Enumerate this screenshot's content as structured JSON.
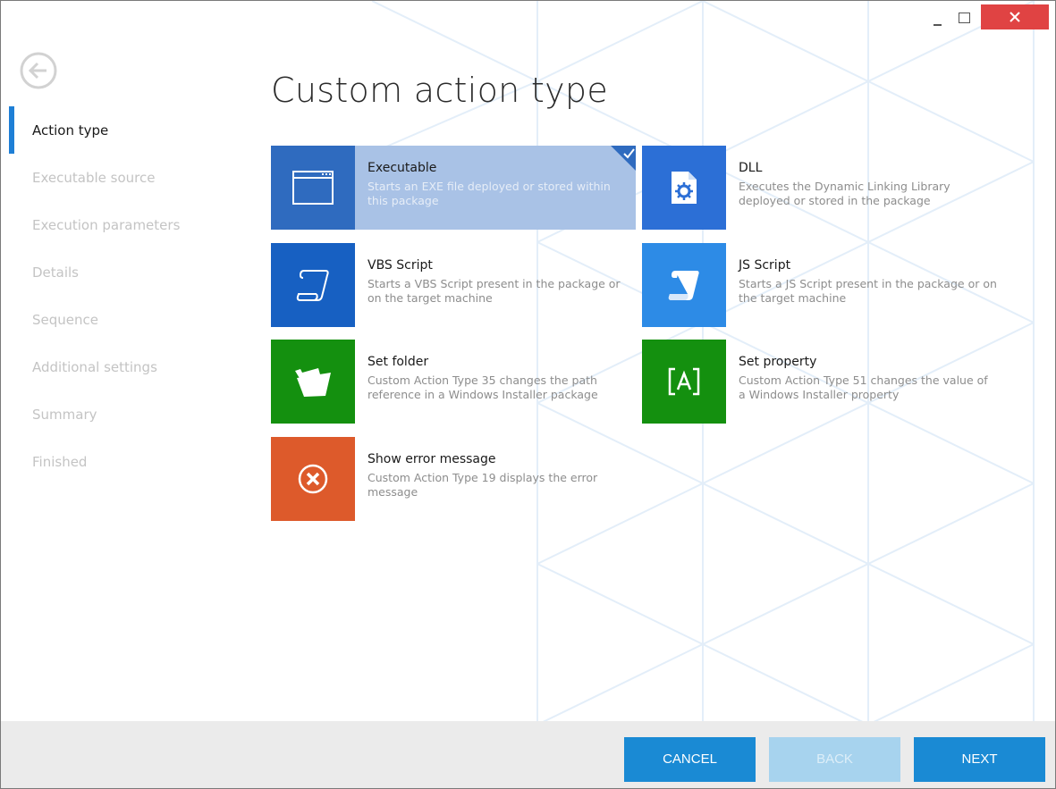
{
  "window": {
    "controls": {
      "minimize": "minimize-icon",
      "maximize": "maximize-icon",
      "close": "close-icon"
    },
    "close_color": "#e04343"
  },
  "back_icon": "back-arrow-icon",
  "sidebar": {
    "accent": "#1e7fd6",
    "steps": [
      {
        "label": "Action type",
        "active": true
      },
      {
        "label": "Executable source",
        "active": false
      },
      {
        "label": "Execution parameters",
        "active": false
      },
      {
        "label": "Details",
        "active": false
      },
      {
        "label": "Sequence",
        "active": false
      },
      {
        "label": "Additional settings",
        "active": false
      },
      {
        "label": "Summary",
        "active": false
      },
      {
        "label": "Finished",
        "active": false
      }
    ]
  },
  "page": {
    "title": "Custom action type"
  },
  "tiles": [
    {
      "title": "Executable",
      "desc": "Starts an EXE file deployed or stored within this package",
      "color": "#2f6bbf",
      "icon": "window-icon",
      "selected": true
    },
    {
      "title": "DLL",
      "desc": "Executes the Dynamic Linking Library deployed or stored in the package",
      "color": "#2c6fd6",
      "icon": "dll-file-gear-icon",
      "selected": false
    },
    {
      "title": "VBS Script",
      "desc": "Starts a VBS Script present in the package or on the target machine",
      "color": "#1760c2",
      "icon": "script-scroll-icon",
      "selected": false
    },
    {
      "title": "JS Script",
      "desc": "Starts a JS Script present in the package or on the target machine",
      "color": "#2d8be6",
      "icon": "script-scroll-filled-icon",
      "selected": false
    },
    {
      "title": "Set folder",
      "desc": "Custom Action Type 35 changes the path reference in a Windows Installer package",
      "color": "#14900f",
      "icon": "folder-open-icon",
      "selected": false
    },
    {
      "title": "Set property",
      "desc": "Custom Action Type 51 changes the value of a Windows Installer property",
      "color": "#14900f",
      "icon": "property-bracket-icon",
      "selected": false
    },
    {
      "title": "Show error message",
      "desc": "Custom Action Type 19 displays the error message",
      "color": "#dd5a2b",
      "icon": "error-circle-icon",
      "selected": false
    }
  ],
  "footer": {
    "cancel": "CANCEL",
    "back": "BACK",
    "next": "NEXT"
  }
}
